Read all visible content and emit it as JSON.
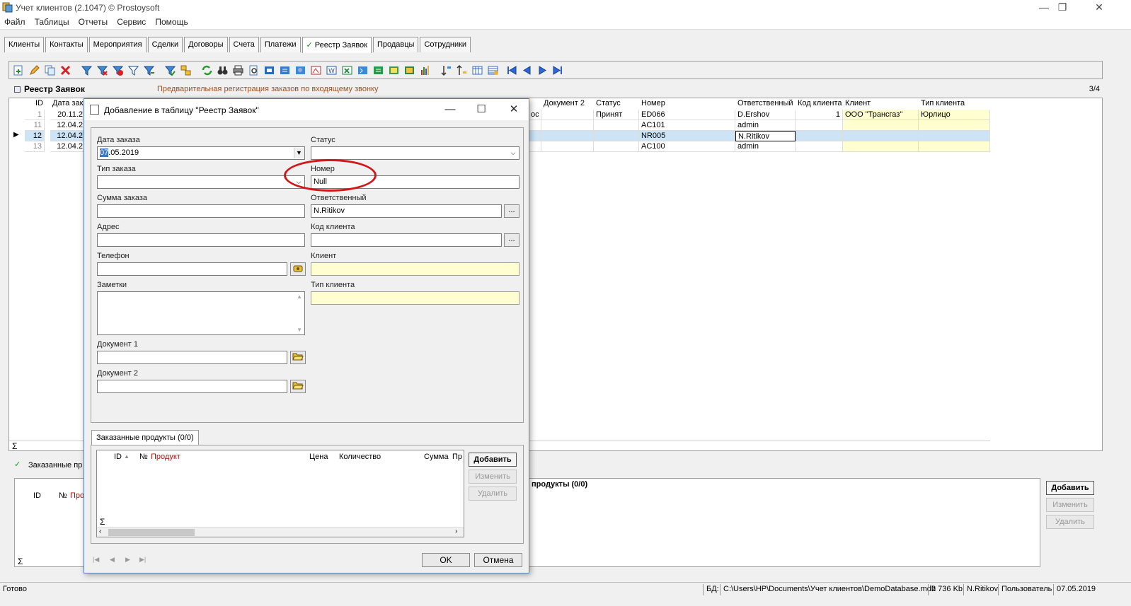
{
  "window": {
    "title": "Учет клиентов (2.1047) © Prostoysoft",
    "controls": [
      "—",
      "❐",
      "✕"
    ]
  },
  "menu": [
    "Файл",
    "Таблицы",
    "Отчеты",
    "Сервис",
    "Помощь"
  ],
  "tabs": [
    "Клиенты",
    "Контакты",
    "Мероприятия",
    "Сделки",
    "Договоры",
    "Счета",
    "Платежи",
    "Реестр Заявок",
    "Продавцы",
    "Сотрудники"
  ],
  "active_tab_index": 7,
  "check_mark": "✓",
  "section": {
    "title": "Реестр Заявок",
    "description": "Предварительная регистрация заказов по входящему звонку",
    "page": "3/4"
  },
  "grid": {
    "headers": {
      "id": "ID",
      "date": "Дата зак",
      "doc2": "Документ 2",
      "status": "Статус",
      "number": "Номер",
      "resp": "Ответственный",
      "client_code": "Код клиента",
      "client": "Клиент",
      "client_type": "Тип клиента"
    },
    "rows": [
      {
        "id": "1",
        "date": "20.11.2",
        "doc_frag": "ос",
        "doc2": "",
        "status": "Принят",
        "number": "ED066",
        "resp": "D.Ershov",
        "client_code": "1",
        "client": "ООО \"Трансгаз\"",
        "client_type": "Юрлицо"
      },
      {
        "id": "11",
        "date": "12.04.2",
        "doc_frag": "",
        "doc2": "",
        "status": "",
        "number": "AC101",
        "resp": "admin",
        "client_code": "",
        "client": "",
        "client_type": ""
      },
      {
        "id": "12",
        "date": "12.04.2",
        "doc_frag": "",
        "doc2": "",
        "status": "",
        "number": "NR005",
        "resp": "N.Ritikov",
        "client_code": "",
        "client": "",
        "client_type": ""
      },
      {
        "id": "13",
        "date": "12.04.2",
        "doc_frag": "",
        "doc2": "",
        "status": "",
        "number": "AC100",
        "resp": "admin",
        "client_code": "",
        "client": "",
        "client_type": ""
      }
    ],
    "selected_row": 2,
    "sum_symbol": "Σ"
  },
  "bottom": {
    "label": "Заказанные пр",
    "headers": {
      "id": "ID",
      "num": "№",
      "product": "Про"
    },
    "right_title": "продукты (0/0)",
    "buttons": {
      "add": "Добавить",
      "edit": "Изменить",
      "delete": "Удалить"
    }
  },
  "dialog": {
    "title": "Добавление в таблицу \"Реестр Заявок\"",
    "controls": [
      "—",
      "☐",
      "✕"
    ],
    "fields": {
      "order_date": {
        "label": "Дата заказа",
        "value_sel": "07",
        "value_rest": ".05.2019"
      },
      "status": {
        "label": "Статус",
        "value": ""
      },
      "order_type": {
        "label": "Тип заказа",
        "value": ""
      },
      "number": {
        "label": "Номер",
        "value": "Null"
      },
      "order_sum": {
        "label": "Сумма заказа",
        "value": ""
      },
      "responsible": {
        "label": "Ответственный",
        "value": "N.Ritikov"
      },
      "address": {
        "label": "Адрес",
        "value": ""
      },
      "client_code": {
        "label": "Код клиента",
        "value": ""
      },
      "phone": {
        "label": "Телефон",
        "value": ""
      },
      "client": {
        "label": "Клиент",
        "value": ""
      },
      "notes": {
        "label": "Заметки",
        "value": ""
      },
      "client_type": {
        "label": "Тип клиента",
        "value": ""
      },
      "doc1": {
        "label": "Документ 1",
        "value": ""
      },
      "doc2": {
        "label": "Документ 2",
        "value": ""
      }
    },
    "ellipsis": "...",
    "subtab": "Заказанные продукты (0/0)",
    "subgrid_headers": {
      "id": "ID",
      "num": "№",
      "product": "Продукт",
      "price": "Цена",
      "qty": "Количество",
      "sum": "Сумма",
      "pri": "Пр"
    },
    "sub_buttons": {
      "add": "Добавить",
      "edit": "Изменить",
      "delete": "Удалить"
    },
    "ok": "OK",
    "cancel": "Отмена"
  },
  "statusbar": {
    "ready": "Готово",
    "db_label": "БД:",
    "db_path": "C:\\Users\\HP\\Documents\\Учет клиентов\\DemoDatabase.mdb",
    "size": "2 736 Kb",
    "user": "N.Ritikov",
    "role": "Пользователь",
    "date": "07.05.2019"
  },
  "colors": {
    "accent": "#3a78d0",
    "annotation": "#d01818",
    "highlight_yellow": "#fefed0",
    "selected_row": "#cde4f7"
  }
}
